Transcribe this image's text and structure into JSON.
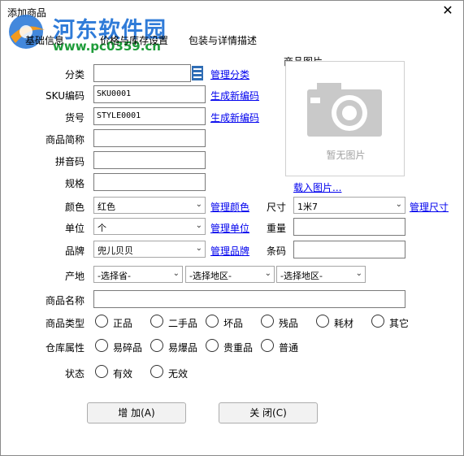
{
  "window": {
    "title": "添加商品"
  },
  "watermark": {
    "name": "河东软件园",
    "url": "www.pc0359.cn"
  },
  "tabs": [
    "基础信息",
    "价格与库存设置",
    "包装与详情描述"
  ],
  "form": {
    "category": {
      "label": "分类",
      "value": "",
      "link": "管理分类"
    },
    "sku": {
      "label": "SKU编码",
      "value": "SKU0001",
      "link": "生成新编码"
    },
    "article": {
      "label": "货号",
      "value": "STYLE0001",
      "link": "生成新编码"
    },
    "short_name": {
      "label": "商品简称",
      "value": ""
    },
    "pinyin": {
      "label": "拼音码",
      "value": ""
    },
    "spec": {
      "label": "规格",
      "value": ""
    },
    "color": {
      "label": "颜色",
      "value": "红色",
      "link": "管理颜色"
    },
    "unit": {
      "label": "单位",
      "value": "个",
      "link": "管理单位"
    },
    "brand": {
      "label": "品牌",
      "value": "兜儿贝贝",
      "link": "管理品牌"
    },
    "size": {
      "label": "尺寸",
      "value": "1米7",
      "link": "管理尺寸"
    },
    "weight": {
      "label": "重量",
      "value": ""
    },
    "barcode": {
      "label": "条码",
      "value": ""
    },
    "origin": {
      "label": "产地",
      "province": "-选择省-",
      "city": "-选择地区-",
      "district": "-选择地区-"
    },
    "product_name": {
      "label": "商品名称",
      "value": ""
    },
    "product_type": {
      "label": "商品类型",
      "options": [
        "正品",
        "二手品",
        "坏品",
        "残品",
        "耗材",
        "其它"
      ]
    },
    "warehouse_attr": {
      "label": "仓库属性",
      "options": [
        "易碎品",
        "易爆品",
        "贵重品",
        "普通"
      ]
    },
    "status": {
      "label": "状态",
      "options": [
        "有效",
        "无效"
      ]
    }
  },
  "image": {
    "group_label": "商品图片",
    "placeholder": "暂无图片",
    "load_link": "载入图片..."
  },
  "buttons": {
    "add": "增 加(A)",
    "close": "关 闭(C)"
  }
}
